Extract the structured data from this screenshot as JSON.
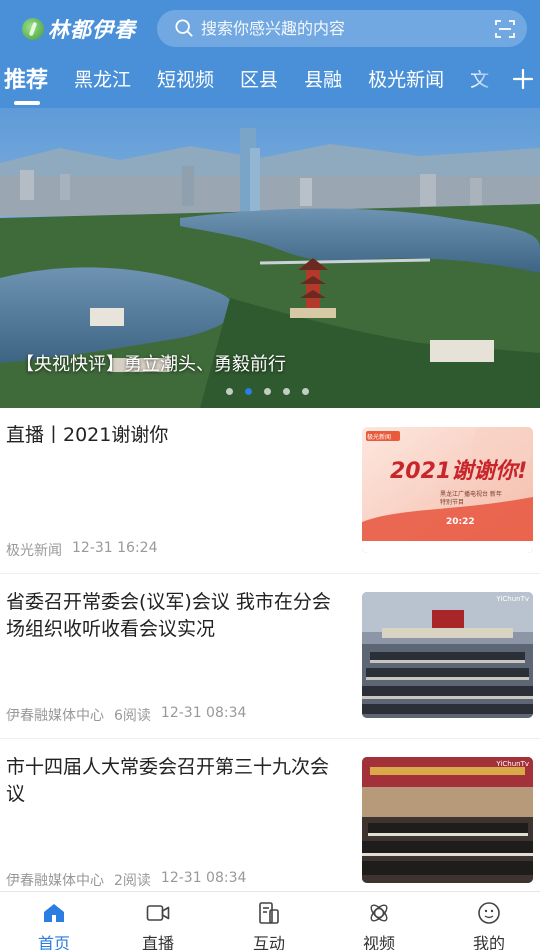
{
  "header": {
    "logo_text": "林都伊春",
    "search_placeholder": "搜索你感兴趣的内容",
    "tabs": [
      "推荐",
      "黑龙江",
      "短视频",
      "区县",
      "县融",
      "极光新闻",
      "文"
    ],
    "active_tab": "推荐"
  },
  "banner": {
    "caption": "【央视快评】勇立潮头、勇毅前行",
    "dot_count": 5,
    "active_dot": 1
  },
  "news": [
    {
      "title": "直播丨2021谢谢你",
      "source": "极光新闻",
      "reads": "",
      "time": "12-31 16:24",
      "thumb_text_main": "2021谢谢你!",
      "thumb_text_sub": "黑龙江广播电视台 新年特别节目",
      "thumb_text_time": "20:22",
      "thumb_brand": "极光新闻"
    },
    {
      "title": "省委召开常委会(议军)会议  我市在分会场组织收听收看会议实况",
      "source": "伊春融媒体中心",
      "reads": "6阅读",
      "time": "12-31 08:34",
      "thumb_watermark": "YiChunTv"
    },
    {
      "title": "市十四届人大常委会召开第三十九次会议",
      "source": "伊春融媒体中心",
      "reads": "2阅读",
      "time": "12-31 08:34",
      "thumb_watermark": "YiChunTv"
    }
  ],
  "bottom_nav": [
    {
      "label": "首页",
      "icon": "home-icon",
      "active": true
    },
    {
      "label": "直播",
      "icon": "camera-icon",
      "active": false
    },
    {
      "label": "互动",
      "icon": "interact-icon",
      "active": false
    },
    {
      "label": "视频",
      "icon": "video-icon",
      "active": false
    },
    {
      "label": "我的",
      "icon": "profile-icon",
      "active": false
    }
  ],
  "colors": {
    "header_bg": "#4a90d9",
    "accent": "#2a7de1",
    "meta_text": "#999999"
  }
}
